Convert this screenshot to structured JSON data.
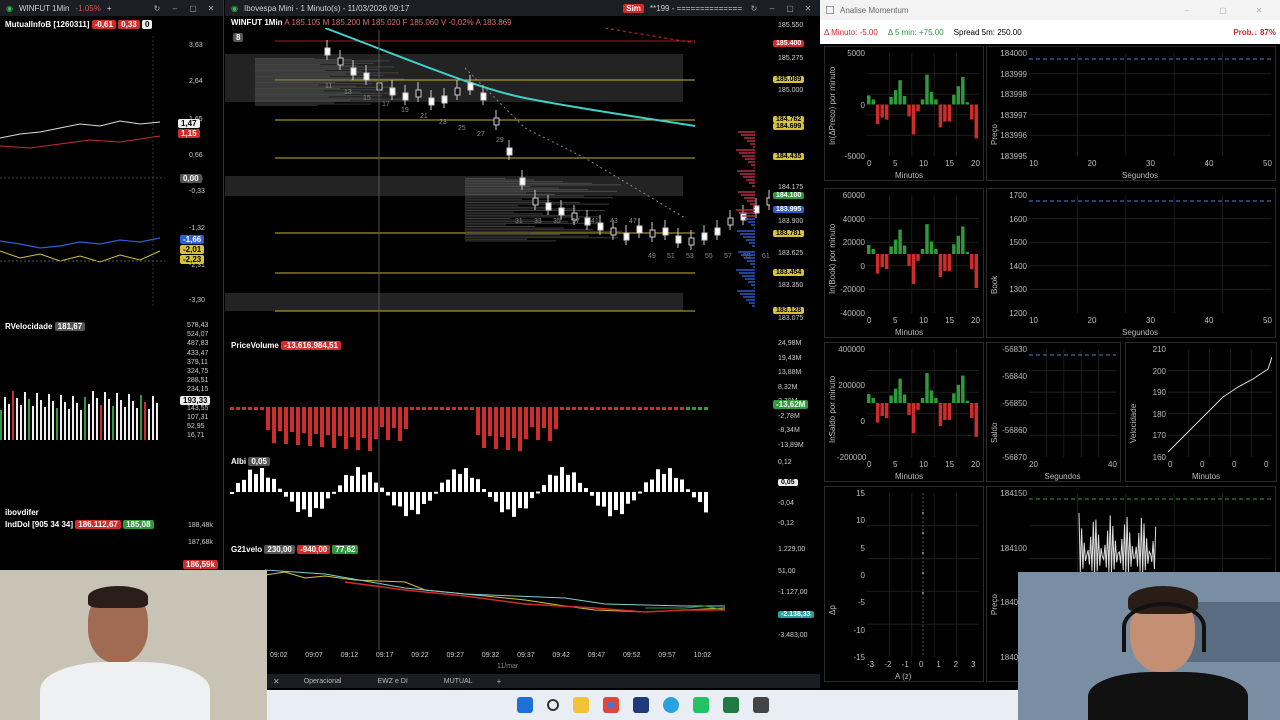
{
  "left_panel": {
    "title": "WINFUT 1Min",
    "title_change": "-1.05%",
    "indicator1": {
      "name": "MutualInfoB [1260311]",
      "v1": "-0,61",
      "v2": "0,33",
      "v3": "0"
    },
    "axis1": [
      "3,63",
      "2,64",
      "1,65",
      "0,66",
      "0,00",
      "-0,33",
      "-1,32",
      "-2,31",
      "-3,30"
    ],
    "tags1": [
      "1,47",
      "1,15",
      "0,00",
      "-1,66",
      "-2,01",
      "-2,23"
    ],
    "indicator2": {
      "name": "RVelocidade",
      "value": "181,67"
    },
    "axis2": [
      "578,43",
      "524,07",
      "487,83",
      "433,47",
      "379,11",
      "324,75",
      "288,51",
      "234,15",
      "179,79",
      "143,55",
      "107,31",
      "52,95",
      "16,71"
    ],
    "tag2": "193,33",
    "indicator3": {
      "name": "ibovdifer"
    },
    "indicator4": {
      "name": "IndDol [905 34 34]",
      "v1": "186.112,67",
      "v2": "185,08"
    },
    "axis4": [
      "188,48k",
      "187,68k",
      "186,88k"
    ],
    "tag4": "186,59k"
  },
  "main_chart": {
    "title": "Ibovespa Mini - 1 Minuto(s) - 11/03/2026 09:17",
    "symbol": "WINFUT 1Min",
    "ohlc": "A 185.105  M 185.200  M 185.020  F 185.060  V -0,02%  A 183.869",
    "sim_label": "Sim",
    "countdown": "**199 - ==============",
    "period_badge": "8",
    "price_axis": [
      "185.550",
      "185.275",
      "185.000",
      "184.725",
      "184.175",
      "183.900",
      "183.625",
      "183.350",
      "183.075"
    ],
    "price_tags": [
      {
        "v": "185.400",
        "c": "#d02c2c",
        "fg": "#fff"
      },
      {
        "v": "185.089",
        "c": "#d8c13a",
        "fg": "#000"
      },
      {
        "v": "184.762",
        "c": "#d8c13a",
        "fg": "#000"
      },
      {
        "v": "184.699",
        "c": "#d8c13a",
        "fg": "#000"
      },
      {
        "v": "184.435",
        "c": "#d8c13a",
        "fg": "#000"
      },
      {
        "v": "184.100",
        "c": "#2f9a3b",
        "fg": "#fff"
      },
      {
        "v": "183.995",
        "c": "#2b5fd3",
        "fg": "#fff"
      },
      {
        "v": "183.781",
        "c": "#d8c13a",
        "fg": "#000"
      },
      {
        "v": "183.454",
        "c": "#d8c13a",
        "fg": "#000"
      },
      {
        "v": "183.128",
        "c": "#d8c13a",
        "fg": "#000"
      }
    ],
    "candle_labels": [
      "11",
      "13",
      "15",
      "17",
      "19",
      "21",
      "23",
      "25",
      "27",
      "29",
      "31",
      "33",
      "35",
      "37",
      "41",
      "43",
      "47",
      "49",
      "51",
      "53",
      "55",
      "57",
      "59",
      "61",
      "63"
    ],
    "pricevolume": {
      "name": "PriceVolume",
      "value": "-13.616.984,51",
      "axis": [
        "24,98M",
        "19,43M",
        "13,88M",
        "8,32M",
        "2,78M",
        "-2,78M",
        "-8,34M",
        "-13,89M"
      ],
      "tag": "-13,62M"
    },
    "albi": {
      "name": "Albi",
      "value": "0,05",
      "axis": [
        "0,12",
        "0,05",
        "-0,04",
        "-0,12"
      ]
    },
    "g21": {
      "name": "G21velo",
      "v1": "230,00",
      "v2": "-940,00",
      "v3": "77,62",
      "axis": [
        "1.229,00",
        "51,00",
        "-1.127,00",
        "-2.138,33",
        "-3.483,00"
      ]
    },
    "time_axis": [
      "09:02",
      "09:07",
      "09:12",
      "09:17",
      "09:22",
      "09:27",
      "09:32",
      "09:37",
      "09:42",
      "09:47",
      "09:52",
      "09:57",
      "10:02"
    ],
    "date_label": "11/mar"
  },
  "tabs": [
    "Operacional",
    "EWZ e DI",
    "MUTUAL"
  ],
  "analysis_window": {
    "title": "Analise Momentum",
    "minuto": "Δ Minuto: -5.00",
    "cinco_min": "Δ 5 min: +75.00",
    "spread": "Spread 5m: 250.00",
    "prob": "Prob.↓ 87%",
    "panels": [
      {
        "id": "p1",
        "ylabel": "In(ΔPreco) por minuto",
        "xlabel": "Minutos",
        "yticks": [
          "5000",
          "0",
          "-5000"
        ],
        "xticks": [
          "0",
          "5",
          "10",
          "15",
          "20"
        ]
      },
      {
        "id": "p2",
        "ylabel": "Preço",
        "xlabel": "Segundos",
        "yticks": [
          "184000",
          "183999",
          "183998",
          "183997",
          "183996",
          "183995"
        ],
        "xticks": [
          "10",
          "20",
          "30",
          "40",
          "50"
        ]
      },
      {
        "id": "p3",
        "ylabel": "In(Book) por minuto",
        "xlabel": "Minutos",
        "yticks": [
          "60000",
          "40000",
          "20000",
          "0",
          "-20000",
          "-40000"
        ],
        "xticks": [
          "0",
          "5",
          "10",
          "15",
          "20"
        ]
      },
      {
        "id": "p4",
        "ylabel": "Book",
        "xlabel": "Segundos",
        "yticks": [
          "1700",
          "1600",
          "1500",
          "1400",
          "1300",
          "1200"
        ],
        "xticks": [
          "10",
          "20",
          "30",
          "40",
          "50"
        ]
      },
      {
        "id": "p5",
        "ylabel": "InSaldo por minuto",
        "xlabel": "Minutos",
        "yticks": [
          "400000",
          "200000",
          "0",
          "-200000"
        ],
        "xticks": [
          "0",
          "5",
          "10",
          "15",
          "20"
        ]
      },
      {
        "id": "p6",
        "ylabel": "Saldo",
        "xlabel": "Segundos",
        "yticks": [
          "-56830",
          "-56840",
          "-56850",
          "-56860",
          "-56870"
        ],
        "xticks": [
          "20",
          "40"
        ]
      },
      {
        "id": "p7",
        "ylabel": "Velocidade",
        "xlabel": "Minutos",
        "yticks": [
          "210",
          "200",
          "190",
          "180",
          "170",
          "160"
        ],
        "xticks": [
          "0",
          "0",
          "0",
          "0"
        ]
      },
      {
        "id": "p8",
        "ylabel": "Δp",
        "xlabel": "A (z)",
        "yticks": [
          "15",
          "10",
          "5",
          "0",
          "-5",
          "-10",
          "-15"
        ],
        "xticks": [
          "-3",
          "-2",
          "-1",
          "0",
          "1",
          "2",
          "3"
        ]
      },
      {
        "id": "p9",
        "ylabel": "Preço",
        "xlabel": "",
        "yticks": [
          "184150",
          "184100",
          "184050",
          "184000"
        ],
        "xticks": []
      }
    ]
  }
}
